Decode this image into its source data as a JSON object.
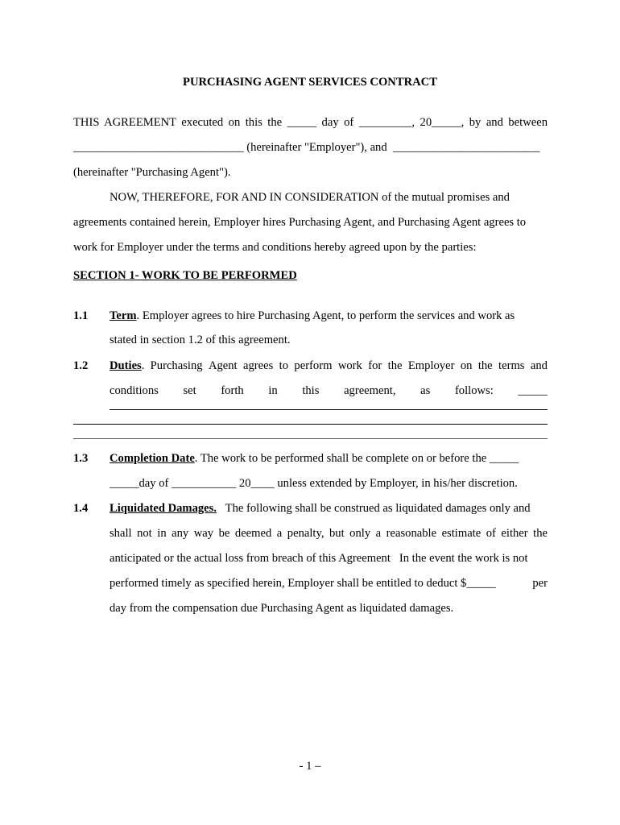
{
  "document": {
    "title": "PURCHASING AGENT SERVICES CONTRACT",
    "preamble": {
      "line1": "THIS AGREEMENT executed on this the _____ day of _________, 20_____,  by  and  between",
      "line2_blank": "_____________________________",
      "line2_text": " (hereinafter \"Employer\"), and ",
      "line2_blank2": "_________________________",
      "line3": "(hereinafter \"Purchasing Agent\").",
      "consideration_1": "NOW, THEREFORE, FOR AND IN CONSIDERATION of the mutual promises and",
      "consideration_2": "agreements contained herein, Employer hires Purchasing Agent, and Purchasing Agent agrees to",
      "consideration_3": "work for Employer under the terms and conditions hereby agreed upon by the parties:"
    },
    "section1": {
      "heading": "SECTION 1- WORK TO BE PERFORMED",
      "items": [
        {
          "number": "1.1",
          "label": "Term",
          "line1": ".  Employer agrees to hire Purchasing Agent, to perform the services and work as",
          "line2": "stated in section 1.2 of this agreement."
        },
        {
          "number": "1.2",
          "label": "Duties",
          "line1": ".  Purchasing Agent agrees to perform work for the Employer on the terms and",
          "line2_words": [
            "conditions",
            "set",
            "forth",
            "in",
            "this",
            "agreement,",
            "as",
            "follows:",
            "_____"
          ]
        },
        {
          "number": "1.3",
          "label": "Completion Date",
          "line1": ".  The work to be performed shall be complete on or before the _____",
          "line2": "_____day of ___________ 20____ unless extended by Employer, in his/her discretion."
        },
        {
          "number": "1.4",
          "label": "Liquidated Damages.",
          "line1": "   The following shall be construed as liquidated damages only and",
          "line2": "shall not in any way be deemed a penalty, but only a reasonable estimate of either the",
          "line3": "anticipated or the actual loss from breach of this Agreement   In the event the work is not",
          "line4_a": "performed timely as specified herein, Employer shall be entitled to deduct $_____",
          "line4_b": "per",
          "line5": "day from the compensation due Purchasing Agent as liquidated damages."
        }
      ]
    },
    "page_number": "- 1 –"
  }
}
